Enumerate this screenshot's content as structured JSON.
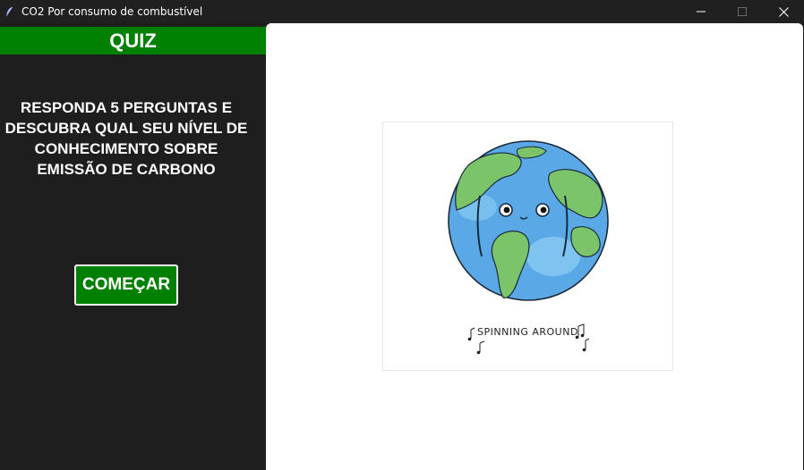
{
  "window": {
    "title": "CO2 Por consumo de combustível",
    "app_icon": "feather-icon",
    "controls": [
      "minimize-icon",
      "maximize-icon",
      "close-icon"
    ]
  },
  "sidebar": {
    "header": "QUIZ",
    "intro": "RESPONDA 5 PERGUNTAS E DESCUBRA QUAL SEU NÍVEL DE CONHECIMENTO SOBRE EMISSÃO DE CARBONO",
    "start_button": "COMEÇAR"
  },
  "main": {
    "image_caption": "SPINNING AROUND"
  },
  "colors": {
    "accent_green": "#008000",
    "dark_bg": "#1e1e1e",
    "titlebar_bg": "#202020",
    "ocean": "#5aa9e6",
    "land": "#7cc46a"
  }
}
